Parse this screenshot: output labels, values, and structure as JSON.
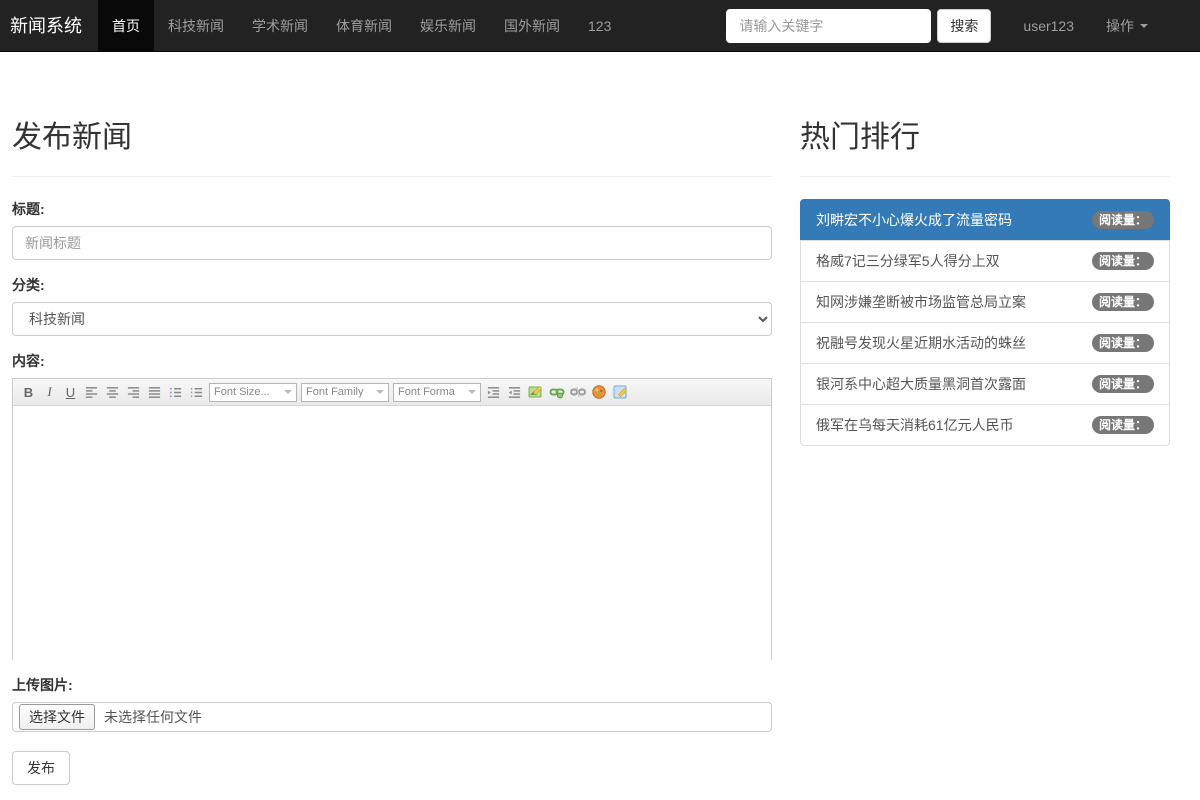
{
  "navbar": {
    "brand": "新闻系统",
    "items": [
      {
        "label": "首页",
        "active": true
      },
      {
        "label": "科技新闻",
        "active": false
      },
      {
        "label": "学术新闻",
        "active": false
      },
      {
        "label": "体育新闻",
        "active": false
      },
      {
        "label": "娱乐新闻",
        "active": false
      },
      {
        "label": "国外新闻",
        "active": false
      },
      {
        "label": "123",
        "active": false
      }
    ],
    "search_placeholder": "请输入关键字",
    "search_button": "搜索",
    "username": "user123",
    "dropdown_label": "操作"
  },
  "form": {
    "page_title": "发布新闻",
    "title_label": "标题:",
    "title_placeholder": "新闻标题",
    "title_value": "",
    "category_label": "分类:",
    "category_value": "科技新闻",
    "content_label": "内容:",
    "editor": {
      "bold": "B",
      "italic": "I",
      "underline": "U",
      "font_size": "Font Size...",
      "font_family": "Font Family",
      "font_format": "Font Forma"
    },
    "upload_label": "上传图片:",
    "file_button": "选择文件",
    "file_status": "未选择任何文件",
    "submit_button": "发布"
  },
  "ranking": {
    "title": "热门排行",
    "badge_label": "阅读量：",
    "items": [
      {
        "title": "刘畊宏不小心爆火成了流量密码",
        "active": true
      },
      {
        "title": "格威7记三分绿军5人得分上双",
        "active": false
      },
      {
        "title": "知网涉嫌垄断被市场监管总局立案",
        "active": false
      },
      {
        "title": "祝融号发现火星近期水活动的蛛丝",
        "active": false
      },
      {
        "title": "银河系中心超大质量黑洞首次露面",
        "active": false
      },
      {
        "title": "俄军在乌每天消耗61亿元人民币",
        "active": false
      }
    ]
  },
  "colors": {
    "navbar_bg": "#222222",
    "navbar_active_bg": "#090909",
    "nav_link": "#9d9d9d",
    "accent_blue": "#337ab7",
    "badge_bg": "#777777",
    "border": "#cccccc"
  }
}
